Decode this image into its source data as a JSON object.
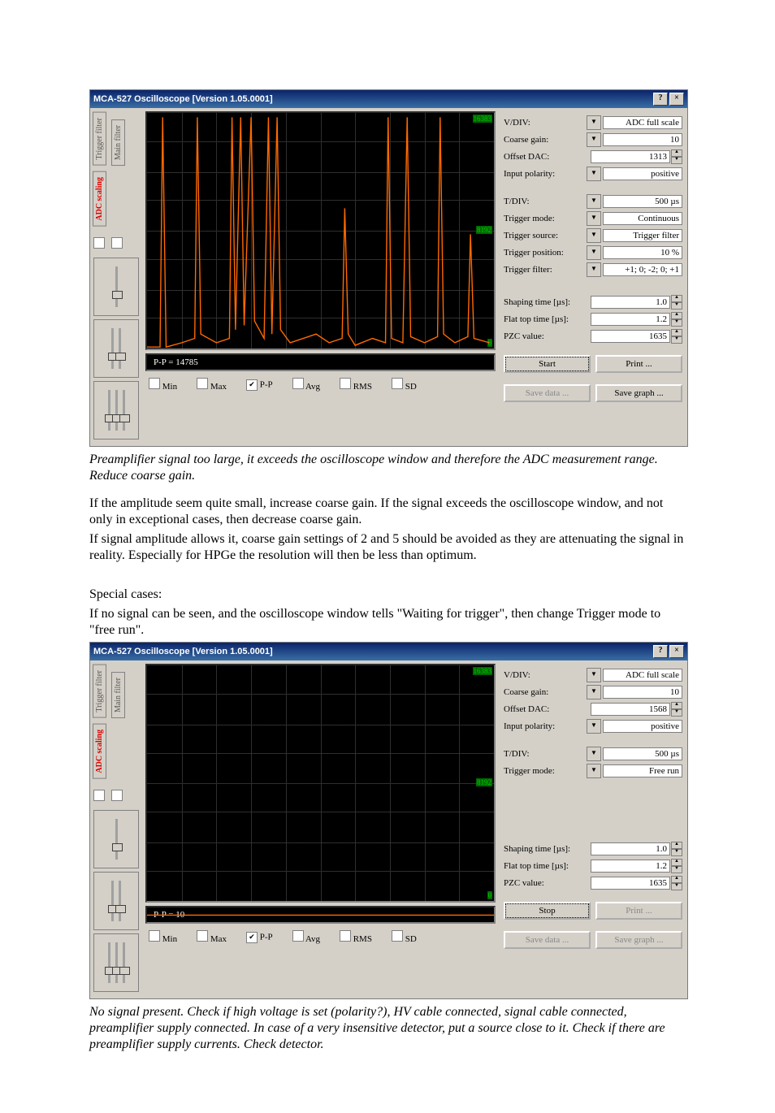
{
  "scope1": {
    "title": "MCA-527 Oscilloscope [Version 1.05.0001]",
    "help": "?",
    "close": "×",
    "tabs": {
      "trigfilt": "Trigger filter",
      "mainfilt": "Main filter",
      "adc": "ADC scaling"
    },
    "pp_label": "P-P = 14785",
    "axis": {
      "top": "16383",
      "mid": "8192",
      "bot": "0"
    },
    "checks": {
      "min": "Min",
      "max": "Max",
      "pp": "P-P",
      "avg": "Avg",
      "rms": "RMS",
      "sd": "SD"
    },
    "params": {
      "vdiv": {
        "lbl": "V/DIV:",
        "val": "ADC full scale"
      },
      "cgain": {
        "lbl": "Coarse gain:",
        "val": "10"
      },
      "odac": {
        "lbl": "Offset DAC:",
        "val": "1313"
      },
      "ipol": {
        "lbl": "Input polarity:",
        "val": "positive"
      },
      "tdiv": {
        "lbl": "T/DIV:",
        "val": "500 µs"
      },
      "tmode": {
        "lbl": "Trigger mode:",
        "val": "Continuous"
      },
      "tsrc": {
        "lbl": "Trigger source:",
        "val": "Trigger filter"
      },
      "tpos": {
        "lbl": "Trigger position:",
        "val": "10 %"
      },
      "tfilt": {
        "lbl": "Trigger filter:",
        "val": "+1; 0; -2; 0; +1"
      },
      "stime": {
        "lbl": "Shaping time [µs]:",
        "val": "1.0"
      },
      "fttime": {
        "lbl": "Flat top time [µs]:",
        "val": "1.2"
      },
      "pzc": {
        "lbl": "PZC value:",
        "val": "1635"
      }
    },
    "btns": {
      "start": "Start",
      "print": "Print ...",
      "savedata": "Save data ...",
      "savegraph": "Save graph ..."
    }
  },
  "caption1": "Preamplifier signal too large, it exceeds the oscilloscope window and therefore the ADC measurement range. Reduce coarse gain.",
  "para1": "If the amplitude seem quite small, increase coarse gain. If the signal exceeds the oscilloscope window, and not only in exceptional cases, then decrease coarse gain.",
  "para2": "If signal amplitude allows it, coarse gain settings of 2 and 5 should be avoided as they are attenuating the signal in reality. Especially for HPGe the resolution will then be less than optimum.",
  "para3": "Special cases:",
  "para4": "If no signal can be seen, and the oscilloscope window tells \"Waiting for trigger\", then change Trigger mode to \"free run\".",
  "scope2": {
    "title": "MCA-527 Oscilloscope [Version 1.05.0001]",
    "help": "?",
    "close": "×",
    "tabs": {
      "trigfilt": "Trigger filter",
      "mainfilt": "Main filter",
      "adc": "ADC scaling"
    },
    "pp_label": "P-P = 10",
    "axis": {
      "top": "16383",
      "mid": "8192",
      "bot": "0"
    },
    "checks": {
      "min": "Min",
      "max": "Max",
      "pp": "P-P",
      "avg": "Avg",
      "rms": "RMS",
      "sd": "SD"
    },
    "params": {
      "vdiv": {
        "lbl": "V/DIV:",
        "val": "ADC full scale"
      },
      "cgain": {
        "lbl": "Coarse gain:",
        "val": "10"
      },
      "odac": {
        "lbl": "Offset DAC:",
        "val": "1568"
      },
      "ipol": {
        "lbl": "Input polarity:",
        "val": "positive"
      },
      "tdiv": {
        "lbl": "T/DIV:",
        "val": "500 µs"
      },
      "tmode": {
        "lbl": "Trigger mode:",
        "val": "Free run"
      },
      "stime": {
        "lbl": "Shaping time [µs]:",
        "val": "1.0"
      },
      "fttime": {
        "lbl": "Flat top time [µs]:",
        "val": "1.2"
      },
      "pzc": {
        "lbl": "PZC value:",
        "val": "1635"
      }
    },
    "btns": {
      "stop": "Stop",
      "print": "Print ...",
      "savedata": "Save data ...",
      "savegraph": "Save graph ..."
    }
  },
  "caption2": "No signal present. Check if high voltage is set (polarity?), HV cable connected, signal cable connected, preamplifier supply connected. In case of a very insensitive detector, put a source close to it. Check if there are preamplifier supply currents. Check detector."
}
